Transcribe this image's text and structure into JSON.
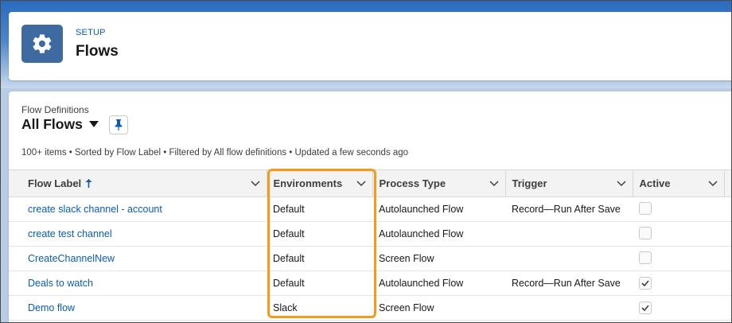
{
  "header": {
    "section_label": "SETUP",
    "title": "Flows",
    "icon": "gear-icon"
  },
  "list": {
    "object_label": "Flow Definitions",
    "view_name": "All Flows",
    "info": "100+ items • Sorted by Flow Label • Filtered by All flow definitions • Updated a few seconds ago",
    "columns": [
      {
        "label": "Flow Label",
        "sorted": "ascending"
      },
      {
        "label": "Environments"
      },
      {
        "label": "Process Type"
      },
      {
        "label": "Trigger"
      },
      {
        "label": "Active"
      }
    ],
    "rows": [
      {
        "label": "create slack channel - account",
        "environment": "Default",
        "process_type": "Autolaunched Flow",
        "trigger": "Record—Run After Save",
        "active": false
      },
      {
        "label": "create test channel",
        "environment": "Default",
        "process_type": "Autolaunched Flow",
        "trigger": "",
        "active": false
      },
      {
        "label": "CreateChannelNew",
        "environment": "Default",
        "process_type": "Screen Flow",
        "trigger": "",
        "active": false
      },
      {
        "label": "Deals to watch",
        "environment": "Default",
        "process_type": "Autolaunched Flow",
        "trigger": "Record—Run After Save",
        "active": true
      },
      {
        "label": "Demo flow",
        "environment": "Slack",
        "process_type": "Screen Flow",
        "trigger": "",
        "active": true
      }
    ]
  },
  "colors": {
    "brand_blue": "#0b5cab",
    "icon_tile": "#3d6aa0",
    "highlight": "#f39b1d",
    "header_bg": "#f3f3f3"
  }
}
